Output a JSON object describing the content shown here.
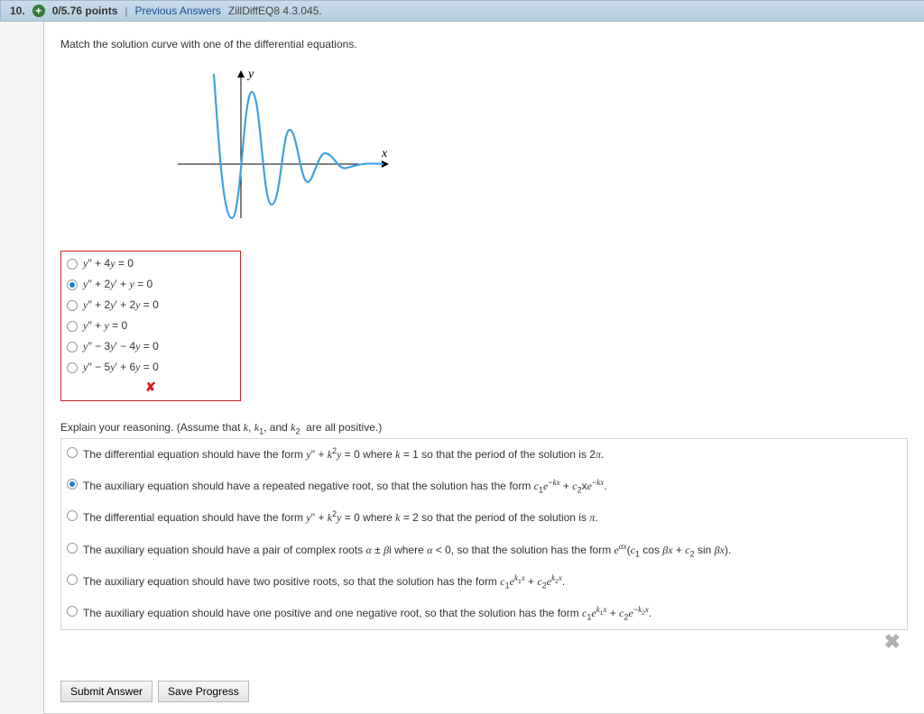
{
  "header": {
    "number": "10.",
    "points": "0/5.76 points",
    "prev": "Previous Answers",
    "source": "ZillDiffEQ8 4.3.045."
  },
  "prompt": "Match the solution curve with one of the differential equations.",
  "graph": {
    "y_label": "y",
    "x_label": "x"
  },
  "options": [
    {
      "selected": false,
      "html": "y'' + 4y = 0"
    },
    {
      "selected": true,
      "html": "y'' + 2y' + y = 0"
    },
    {
      "selected": false,
      "html": "y'' + 2y' + 2y = 0"
    },
    {
      "selected": false,
      "html": "y'' + y = 0"
    },
    {
      "selected": false,
      "html": "y'' − 3y' − 4y = 0"
    },
    {
      "selected": false,
      "html": "y'' − 5y' + 6y = 0"
    }
  ],
  "wrong_mark": "✘",
  "explain_head": "Explain your reasoning. (Assume that k, k₁, and k₂ are all positive.)",
  "explanations": [
    {
      "selected": false,
      "text": "The differential equation should have the form y'' + k²y = 0 where k = 1 so that the period of the solution is 2π."
    },
    {
      "selected": true,
      "text": "The auxiliary equation should have a repeated negative root, so that the solution has the form c₁e⁻ᵏˣ + c₂xe⁻ᵏˣ."
    },
    {
      "selected": false,
      "text": "The differential equation should have the form y'' + k²y = 0 where k = 2 so that the period of the solution is π."
    },
    {
      "selected": false,
      "text": "The auxiliary equation should have a pair of complex roots α ± βi where α < 0, so that the solution has the form eᵅˣ(c₁ cos βx + c₂ sin βx)."
    },
    {
      "selected": false,
      "text": "The auxiliary equation should have two positive roots, so that the solution has the form c₁eᵏ¹ˣ + c₂eᵏ²ˣ."
    },
    {
      "selected": false,
      "text": "The auxiliary equation should have one positive and one negative root, so that the solution has the form c₁eᵏ¹ˣ + c₂e⁻ᵏ²ˣ."
    }
  ],
  "close_x": "✖",
  "buttons": {
    "submit": "Submit Answer",
    "save": "Save Progress"
  }
}
